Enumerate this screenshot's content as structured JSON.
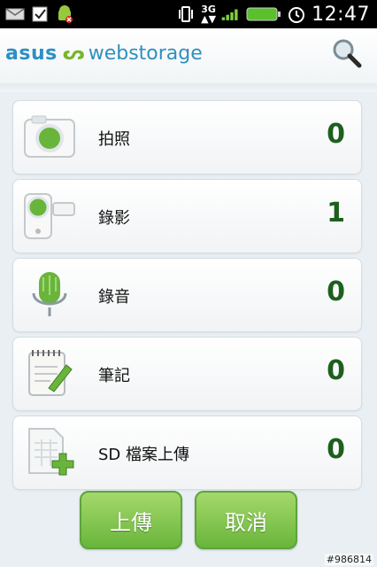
{
  "status_bar": {
    "time": "12:47",
    "network": "3G",
    "icons": [
      "email-icon",
      "checkbox-icon",
      "android-debug-icon",
      "vibrate-icon",
      "signal-bars-icon",
      "battery-icon",
      "alarm-clock-icon"
    ]
  },
  "header": {
    "logo_asus": "asus",
    "logo_mark": "ᔕ",
    "logo_product": "webstorage",
    "search_icon": "search-icon"
  },
  "items": [
    {
      "label": "拍照",
      "count": "0",
      "icon": "camera-icon"
    },
    {
      "label": "錄影",
      "count": "1",
      "icon": "video-camera-icon"
    },
    {
      "label": "錄音",
      "count": "0",
      "icon": "microphone-icon"
    },
    {
      "label": "筆記",
      "count": "0",
      "icon": "notepad-icon"
    },
    {
      "label": "SD 檔案上傳",
      "count": "0",
      "icon": "sd-upload-icon"
    }
  ],
  "buttons": {
    "upload_label": "上傳",
    "cancel_label": "取消"
  },
  "watermark": "#986814",
  "colors": {
    "accent_green": "#69b53b",
    "count_green": "#1d5f1d",
    "logo_blue": "#2c8fc5"
  }
}
